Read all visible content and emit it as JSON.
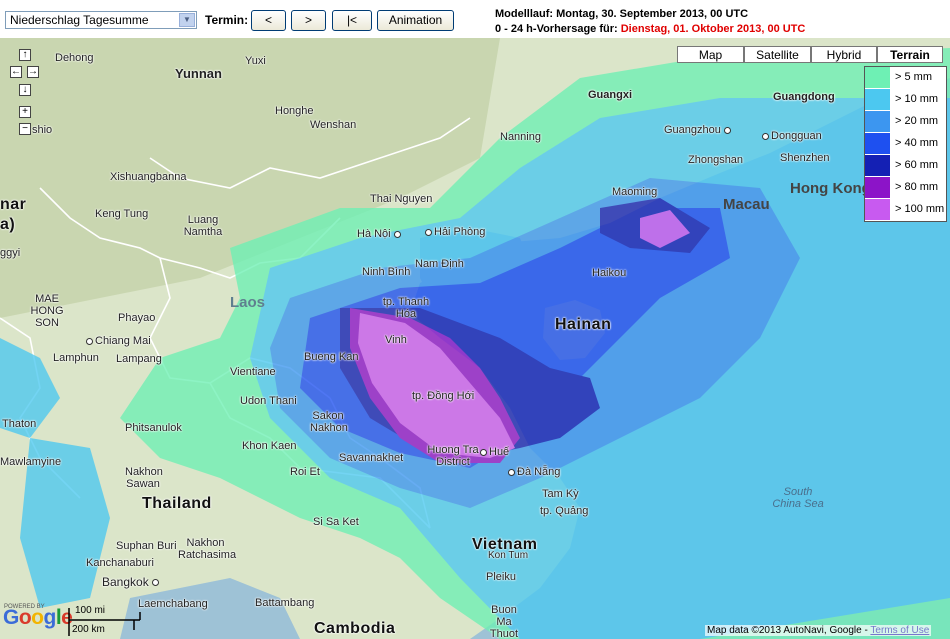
{
  "toolbar": {
    "variable": "Niederschlag Tagesumme",
    "termin_label": "Termin:",
    "prev_label": "<",
    "next_label": ">",
    "first_label": "|<",
    "animation_label": "Animation"
  },
  "header": {
    "run_line": "Modelllauf: Montag, 30. September 2013, 00 UTC",
    "forecast_prefix": "0 - 24 h-Vorhersage für: ",
    "forecast_date": "Dienstag, 01. Oktober 2013, 00 UTC"
  },
  "map_types": [
    "Map",
    "Satellite",
    "Hybrid",
    "Terrain"
  ],
  "active_map_type": "Terrain",
  "legend": [
    {
      "label": "> 5 mm",
      "color": "#6ef0b4"
    },
    {
      "label": "> 10 mm",
      "color": "#4cc8f0"
    },
    {
      "label": "> 20 mm",
      "color": "#3c96f0"
    },
    {
      "label": "> 40 mm",
      "color": "#1e50f0"
    },
    {
      "label": "> 60 mm",
      "color": "#1420b4"
    },
    {
      "label": "> 80 mm",
      "color": "#8c14c8"
    },
    {
      "label": "> 100 mm",
      "color": "#c85af0"
    }
  ],
  "nav_controls": {
    "up": "↑",
    "left": "←",
    "right": "→",
    "down": "↓",
    "zoom_in": "+",
    "zoom_out": "−"
  },
  "places": {
    "yunnan": "Yunnan",
    "dehong": "Dehong",
    "yuxi": "Yuxi",
    "honghe": "Honghe",
    "wenshan": "Wenshan",
    "guangxi": "Guangxi",
    "guangdong": "Guangdong",
    "nanning": "Nanning",
    "guangzhou": "Guangzhou",
    "dongguan": "Dongguan",
    "zhongshan": "Zhongshan",
    "shenzhen": "Shenzhen",
    "hong_kong": "Hong Kong",
    "macau": "Macau",
    "maoming": "Maoming",
    "haikou": "Haikou",
    "hainan": "Hainan",
    "xishuangbanna": "Xishuangbanna",
    "kengtung": "Keng Tung",
    "luang_namtha": "Luang\nNamtha",
    "thai_nguyen": "Thai Nguyen",
    "hanoi": "Hà Nội",
    "haiphong": "Hải Phòng",
    "nam_dinh": "Nam Định",
    "ninh_binh": "Ninh Bình",
    "thanh_hoa": "tp. Thanh\nHóa",
    "vinh": "Vinh",
    "laos": "Laos",
    "shio": "shio",
    "mar": "nar",
    "a": "a)",
    "ggyi": "ggyi",
    "mae_hong_son": "MAE\nHONG SON",
    "phayao": "Phayao",
    "chiang_mai": "Chiang Mai",
    "lampang": "Lampang",
    "lamphun": "Lamphun",
    "bueng_kan": "Bueng Kan",
    "vientiane": "Vientiane",
    "udon_thani": "Udon Thani",
    "sakon_nakhon": "Sakon\nNakhon",
    "dong_hoi": "tp. Đồng Hới",
    "phitsanulok": "Phitsanulok",
    "thaton": "Thaton",
    "mawlamyine": "Mawlamyine",
    "khon_kaen": "Khon Kaen",
    "savannakhet": "Savannakhet",
    "huong_tra": "Huong Tra\nDistrict",
    "hue": "Huế",
    "da_nang": "Đà Nẵng",
    "tam_ky": "Tam Kỳ",
    "quang": "tp. Quảng",
    "nakhon_sawan": "Nakhon\nSawan",
    "roi_et": "Roi Et",
    "thailand": "Thailand",
    "si_sa_ket": "Si Sa Ket",
    "suphan_buri": "Suphan Buri",
    "nakhon_ratchasima": "Nakhon\nRatchasima",
    "kanchanaburi": "Kanchanaburi",
    "bangkok": "Bangkok",
    "laem": "Laemchabang",
    "battambang": "Battambang",
    "cambodia": "Cambodia",
    "vietnam": "Vietnam",
    "kon_tum": "Kon Tum",
    "pleiku": "Pleiku",
    "buon_ma": "Buon Ma\nThuot",
    "south_china_sea": "South\nChina Sea"
  },
  "scale": {
    "mi": "100 mi",
    "km": "200 km"
  },
  "logo": {
    "powered": "POWERED BY",
    "name": "Google"
  },
  "attribution": {
    "text": "Map data ©2013 AutoNavi, Google - ",
    "link": "Terms of Use"
  }
}
